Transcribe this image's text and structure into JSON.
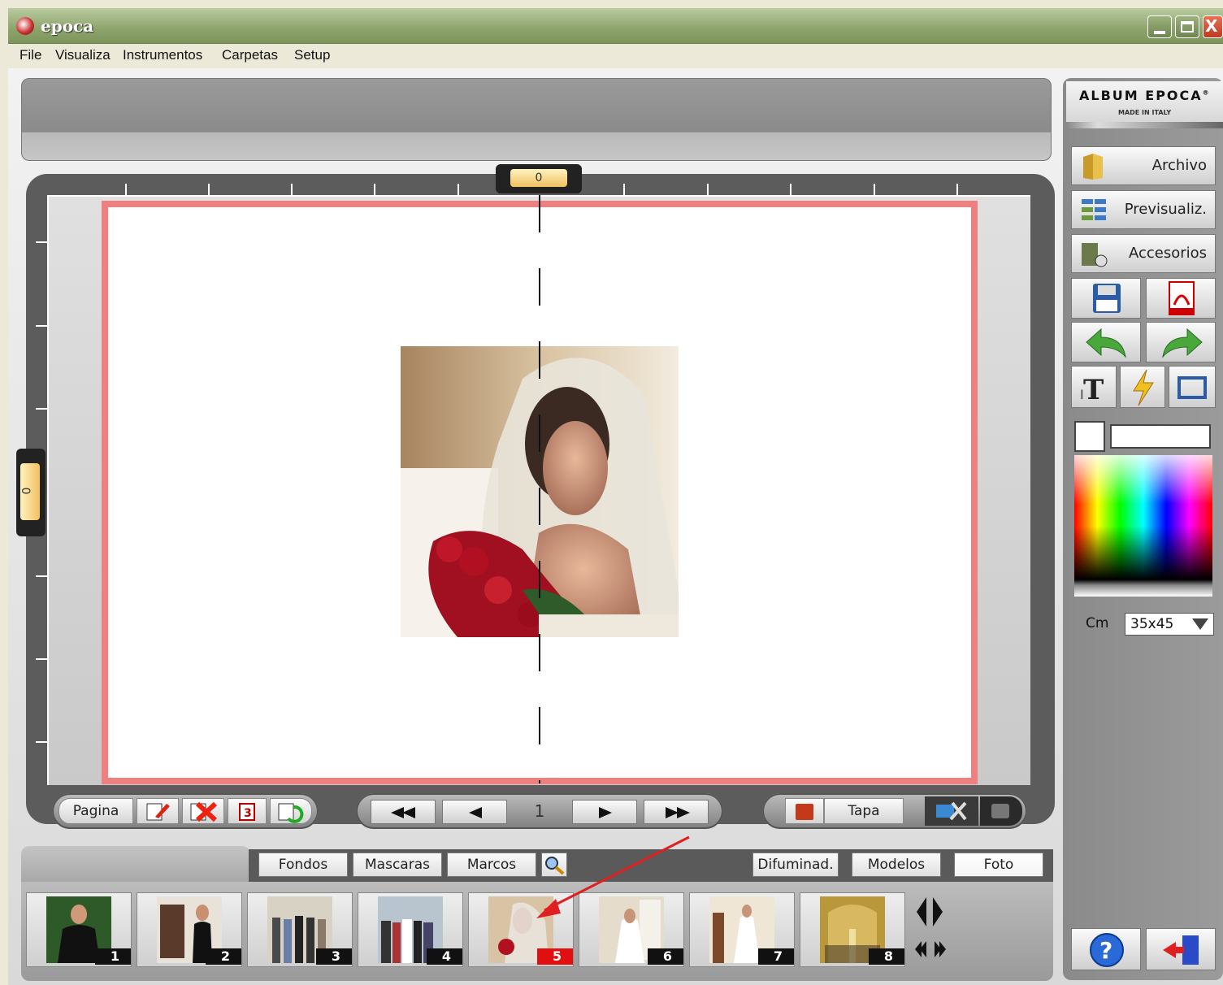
{
  "window": {
    "title": "epoca"
  },
  "menu": [
    "File",
    "Visualiza",
    "Instrumentos",
    "Carpetas",
    "Setup"
  ],
  "rulers": {
    "horizontal_value": "0",
    "vertical_value": "0"
  },
  "page_controls": {
    "label": "Pagina",
    "page_number": "1"
  },
  "cover_controls": {
    "label": "Tapa"
  },
  "tabs": {
    "fondos": "Fondos",
    "mascaras": "Mascaras",
    "marcos": "Marcos",
    "difuminad": "Difuminad.",
    "modelos": "Modelos",
    "foto": "Foto"
  },
  "thumbnails": [
    {
      "num": "1",
      "selected": false
    },
    {
      "num": "2",
      "selected": false
    },
    {
      "num": "3",
      "selected": false
    },
    {
      "num": "4",
      "selected": false
    },
    {
      "num": "5",
      "selected": true
    },
    {
      "num": "6",
      "selected": false
    },
    {
      "num": "7",
      "selected": false
    },
    {
      "num": "8",
      "selected": false
    }
  ],
  "sidebar": {
    "brand": "ALBUM EPOCA",
    "brand_mark": "®",
    "brand_sub": "MADE IN ITALY",
    "archivo": "Archivo",
    "previsualiz": "Previsualiz.",
    "accesorios": "Accesorios",
    "unit_label": "Cm",
    "size_value": "35x45"
  },
  "colors": {
    "page_border": "#f08080",
    "selected_thumb": "#e10f0f",
    "titlebar": "#8da46c"
  }
}
